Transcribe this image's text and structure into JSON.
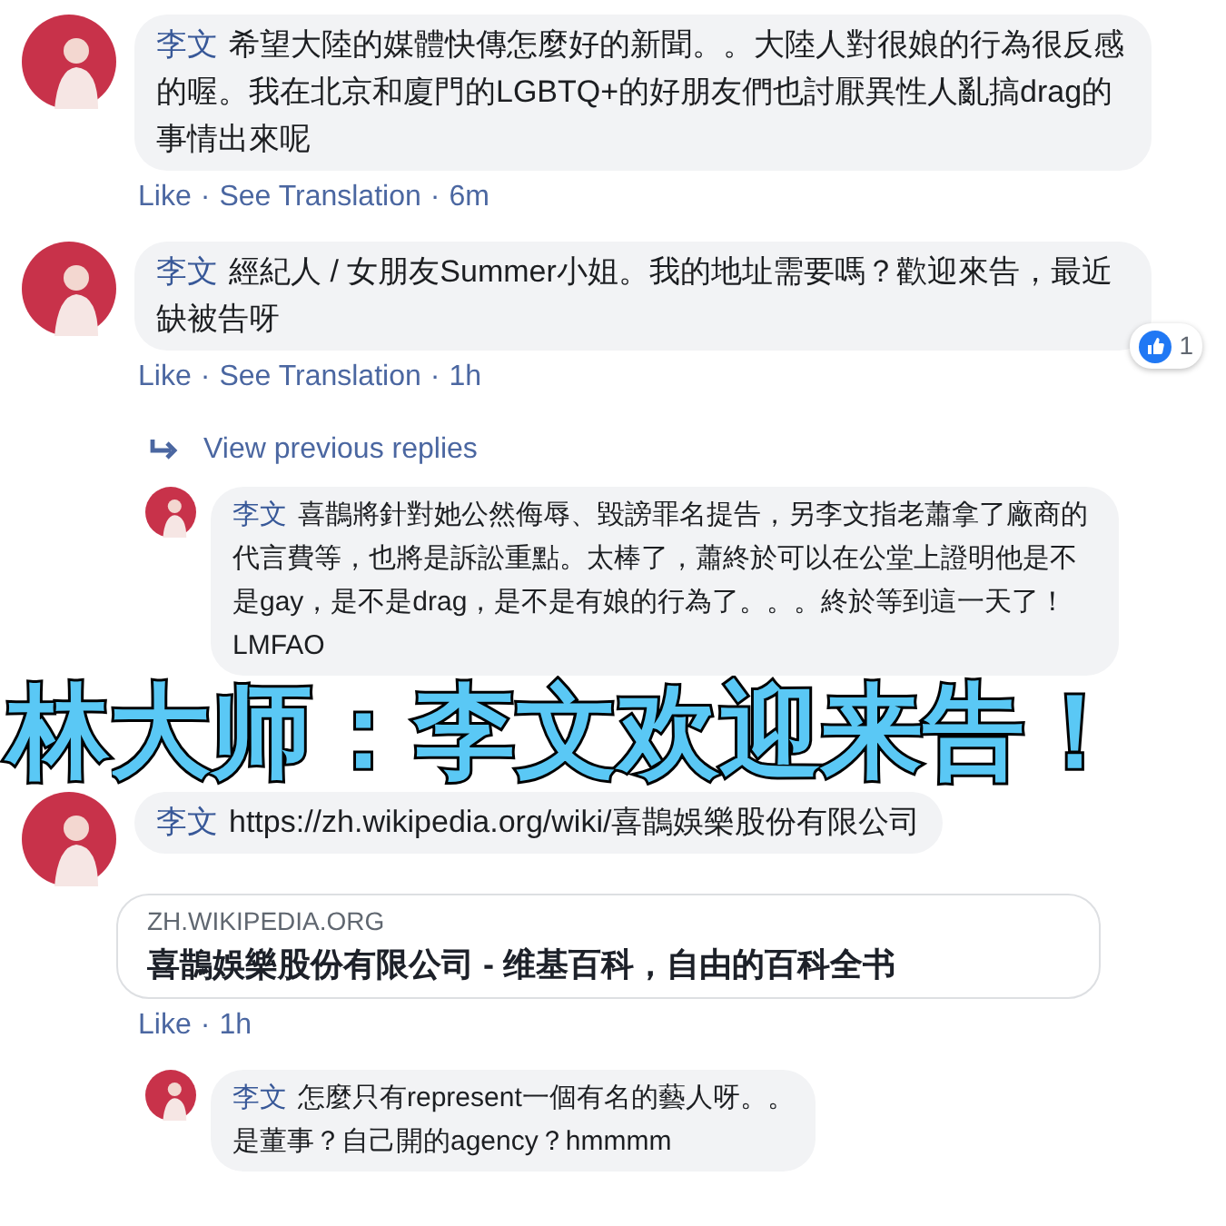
{
  "separator": "·",
  "thread": [
    {
      "kind": "comment",
      "author": "李文",
      "lines": [
        "希望大陸的媒體快傳怎麼好的新聞。。大陸人對很娘的行為很反感的喔。我在北京和廈門的LGBTQ+的好朋友們也討厭異性人亂搞drag的事情出來呢"
      ],
      "actions": [
        "Like",
        "See Translation"
      ],
      "time": "6m"
    },
    {
      "kind": "comment",
      "author": "李文",
      "lines": [
        "經紀人 / 女朋友Summer小姐。我的地址需要嗎？歡迎來告，最近缺被告呀"
      ],
      "actions": [
        "Like",
        "See Translation"
      ],
      "time": "1h",
      "reaction_count": "1"
    },
    {
      "kind": "view_replies",
      "label": "View previous replies"
    },
    {
      "kind": "reply",
      "author": "李文",
      "lines": [
        "喜鵲將針對她公然侮辱、毀謗罪名提告，另李文指老蕭拿了廠商的代言費等，也將是訴訟重點。太棒了，蕭終於可以在公堂上證明他是不是gay，是不是drag，是不是有娘的行為了。。。終於等到這一天了！LMFAO"
      ]
    },
    {
      "kind": "caption",
      "text": "林大师：李文欢迎来告！"
    },
    {
      "kind": "comment",
      "author": "李文",
      "lines": [
        "https://zh.wikipedia.org/wiki/喜鵲娛樂股份有限公司"
      ],
      "preview": {
        "domain": "ZH.WIKIPEDIA.ORG",
        "title": "喜鵲娛樂股份有限公司 - 维基百科，自由的百科全书"
      },
      "actions": [
        "Like"
      ],
      "time": "1h"
    },
    {
      "kind": "reply",
      "author": "李文",
      "lines": [
        "怎麼只有represent一個有名的藝人呀。。",
        "是董事？自己開的agency？hmmmm"
      ]
    }
  ]
}
